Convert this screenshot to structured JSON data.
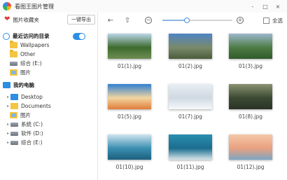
{
  "app": {
    "title": "看图王图片管理"
  },
  "window_controls": [
    "-",
    "□",
    "×"
  ],
  "sidebar": {
    "favorites_label": "图片收藏夹",
    "export_label": "一键导出",
    "items": [
      {
        "label": "最近访问的目录",
        "icon": "recent-icon",
        "bold": true,
        "toggle": true
      },
      {
        "label": "Wallpapers",
        "icon": "folder-icon"
      },
      {
        "label": "Other",
        "icon": "folder-icon"
      },
      {
        "label": "综合 (E:)",
        "icon": "drive-icon"
      },
      {
        "label": "图片",
        "icon": "picture-folder-icon"
      },
      {
        "label": "我的电脑",
        "icon": "computer-icon",
        "bold": true
      },
      {
        "label": "Desktop",
        "icon": "desktop-icon",
        "expandable": true
      },
      {
        "label": "Documents",
        "icon": "documents-icon",
        "expandable": true
      },
      {
        "label": "图片",
        "icon": "picture-folder-icon"
      },
      {
        "label": "系统 (C:)",
        "icon": "drive-icon",
        "expandable": true
      },
      {
        "label": "软件 (D:)",
        "icon": "drive-icon",
        "expandable": true
      },
      {
        "label": "综合 (E:)",
        "icon": "drive-icon",
        "expandable": true
      }
    ]
  },
  "toolbar": {
    "back_glyph": "←",
    "up_glyph": "⇧",
    "zoom_out_glyph": "−",
    "zoom_in_glyph": "+",
    "zoom_level": 0.35,
    "select_all_label": "全选"
  },
  "photos": [
    {
      "name": "01(1).jpg",
      "colors": [
        "#b9d6e8",
        "#3d6b2e",
        "#6f8e55"
      ]
    },
    {
      "name": "01(2).jpg",
      "colors": [
        "#4f84c4",
        "#7a8a6b",
        "#4a5d3a"
      ]
    },
    {
      "name": "01(3).jpg",
      "colors": [
        "#9cb7cc",
        "#4e7c45",
        "#2f5b2a"
      ]
    },
    {
      "name": "01(5).jpg",
      "colors": [
        "#2f7fd0",
        "#f2d5a0",
        "#e07d3a"
      ]
    },
    {
      "name": "01(7).jpg",
      "colors": [
        "#e8eef3",
        "#cfd9e2",
        "#f7f9fb"
      ]
    },
    {
      "name": "01(8).jpg",
      "colors": [
        "#8a9270",
        "#3c4a34",
        "#2a3326"
      ]
    },
    {
      "name": "01(10).jpg",
      "colors": [
        "#cfe3ef",
        "#3a8fb0",
        "#1d5f7e"
      ]
    },
    {
      "name": "01(11).jpg",
      "colors": [
        "#2a8fae",
        "#1b6d8f",
        "#d8e6ea"
      ]
    },
    {
      "name": "01(12).jpg",
      "colors": [
        "#f5c8a8",
        "#e8a080",
        "#7ca6c4"
      ]
    }
  ]
}
